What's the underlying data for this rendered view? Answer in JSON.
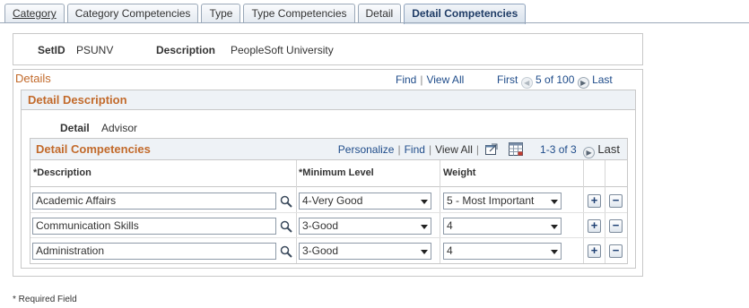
{
  "tabs": [
    {
      "label": "Category"
    },
    {
      "label": "Category Competencies"
    },
    {
      "label": "Type"
    },
    {
      "label": "Type Competencies"
    },
    {
      "label": "Detail"
    },
    {
      "label": "Detail Competencies"
    }
  ],
  "header": {
    "setid_label": "SetID",
    "setid_value": "PSUNV",
    "description_label": "Description",
    "description_value": "PeopleSoft University"
  },
  "details": {
    "title": "Details",
    "find": "Find",
    "view_all": "View All",
    "first": "First",
    "range": "5 of 100",
    "last": "Last",
    "section_title": "Detail Description",
    "detail_label": "Detail",
    "detail_value": "Advisor"
  },
  "grid": {
    "title": "Detail Competencies",
    "personalize": "Personalize",
    "find": "Find",
    "view_all": "View All",
    "range": "1-3 of 3",
    "last": "Last",
    "columns": {
      "description": "*Description",
      "minimum_level": "*Minimum Level",
      "weight": "Weight"
    },
    "rows": [
      {
        "description": "Academic Affairs",
        "minimum_level": "4-Very Good",
        "weight": "5 - Most Important"
      },
      {
        "description": "Communication Skills",
        "minimum_level": "3-Good",
        "weight": "4"
      },
      {
        "description": "Administration",
        "minimum_level": "3-Good",
        "weight": "4"
      }
    ],
    "add_symbol": "+",
    "delete_symbol": "−"
  },
  "footer": {
    "required_note": "* Required Field"
  },
  "icons": {
    "lookup": "magnifier-icon",
    "prev": "arrow-left-icon",
    "next": "arrow-right-icon",
    "zoom": "zoom-window-icon",
    "download": "spreadsheet-icon"
  },
  "colors": {
    "section_title": "#c26a2b",
    "link": "#1f4c8a",
    "header_bg": "#eef2f6"
  }
}
